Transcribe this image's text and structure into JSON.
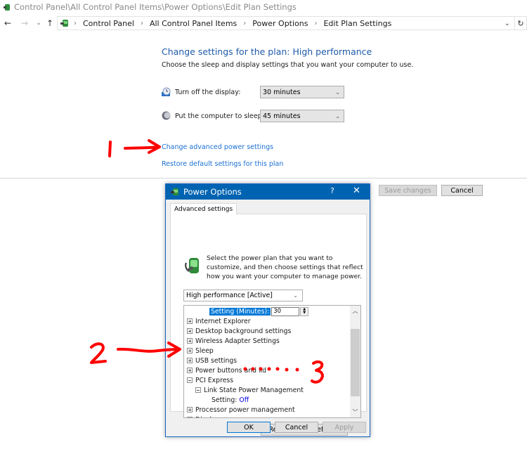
{
  "window": {
    "title": "Control Panel\\All Control Panel Items\\Power Options\\Edit Plan Settings",
    "icon": "control-panel-power-icon"
  },
  "nav": {
    "back_icon": "←",
    "forward_icon": "→",
    "recent_icon": "⌄",
    "up_icon": "↑",
    "refresh_icon": "↻",
    "dropdown_icon": "⌄",
    "breadcrumbs": [
      "Control Panel",
      "All Control Panel Items",
      "Power Options",
      "Edit Plan Settings"
    ],
    "separator": "›"
  },
  "main": {
    "heading": "Change settings for the plan: High performance",
    "subtitle": "Choose the sleep and display settings that you want your computer to use.",
    "settings": [
      {
        "label": "Turn off the display:",
        "value": "30 minutes",
        "icon": "monitor-clock-icon"
      },
      {
        "label": "Put the computer to sleep:",
        "value": "45 minutes",
        "icon": "moon-icon"
      }
    ],
    "links": {
      "advanced": "Change advanced power settings",
      "restore": "Restore default settings for this plan"
    },
    "buttons": {
      "save": "Save changes",
      "cancel": "Cancel"
    },
    "chevron": "⌄"
  },
  "dialog": {
    "title": "Power Options",
    "help": "?",
    "close": "✕",
    "tab": "Advanced settings",
    "description": "Select the power plan that you want to customize, and then choose settings that reflect how you want your computer to manage power.",
    "plan_select": "High performance [Active]",
    "tree": {
      "setting_minutes_label": "Setting (Minutes):",
      "setting_minutes_value": "30",
      "items": [
        {
          "label": "Internet Explorer",
          "expanded": false
        },
        {
          "label": "Desktop background settings",
          "expanded": false
        },
        {
          "label": "Wireless Adapter Settings",
          "expanded": false
        },
        {
          "label": "Sleep",
          "expanded": false
        },
        {
          "label": "USB settings",
          "expanded": false
        },
        {
          "label": "Power buttons and lid",
          "expanded": false
        },
        {
          "label": "PCI Express",
          "expanded": true
        },
        {
          "label": "Link State Power Management",
          "expanded": true
        },
        {
          "label": "Setting:",
          "value": "Off"
        },
        {
          "label": "Processor power management",
          "expanded": false
        },
        {
          "label": "Display",
          "expanded": false
        }
      ]
    },
    "buttons": {
      "restore": "Restore plan defaults",
      "ok": "OK",
      "cancel": "Cancel",
      "apply": "Apply"
    }
  },
  "annotations": {
    "color": "#ff0000",
    "marks": [
      "1",
      "2",
      "3"
    ]
  }
}
